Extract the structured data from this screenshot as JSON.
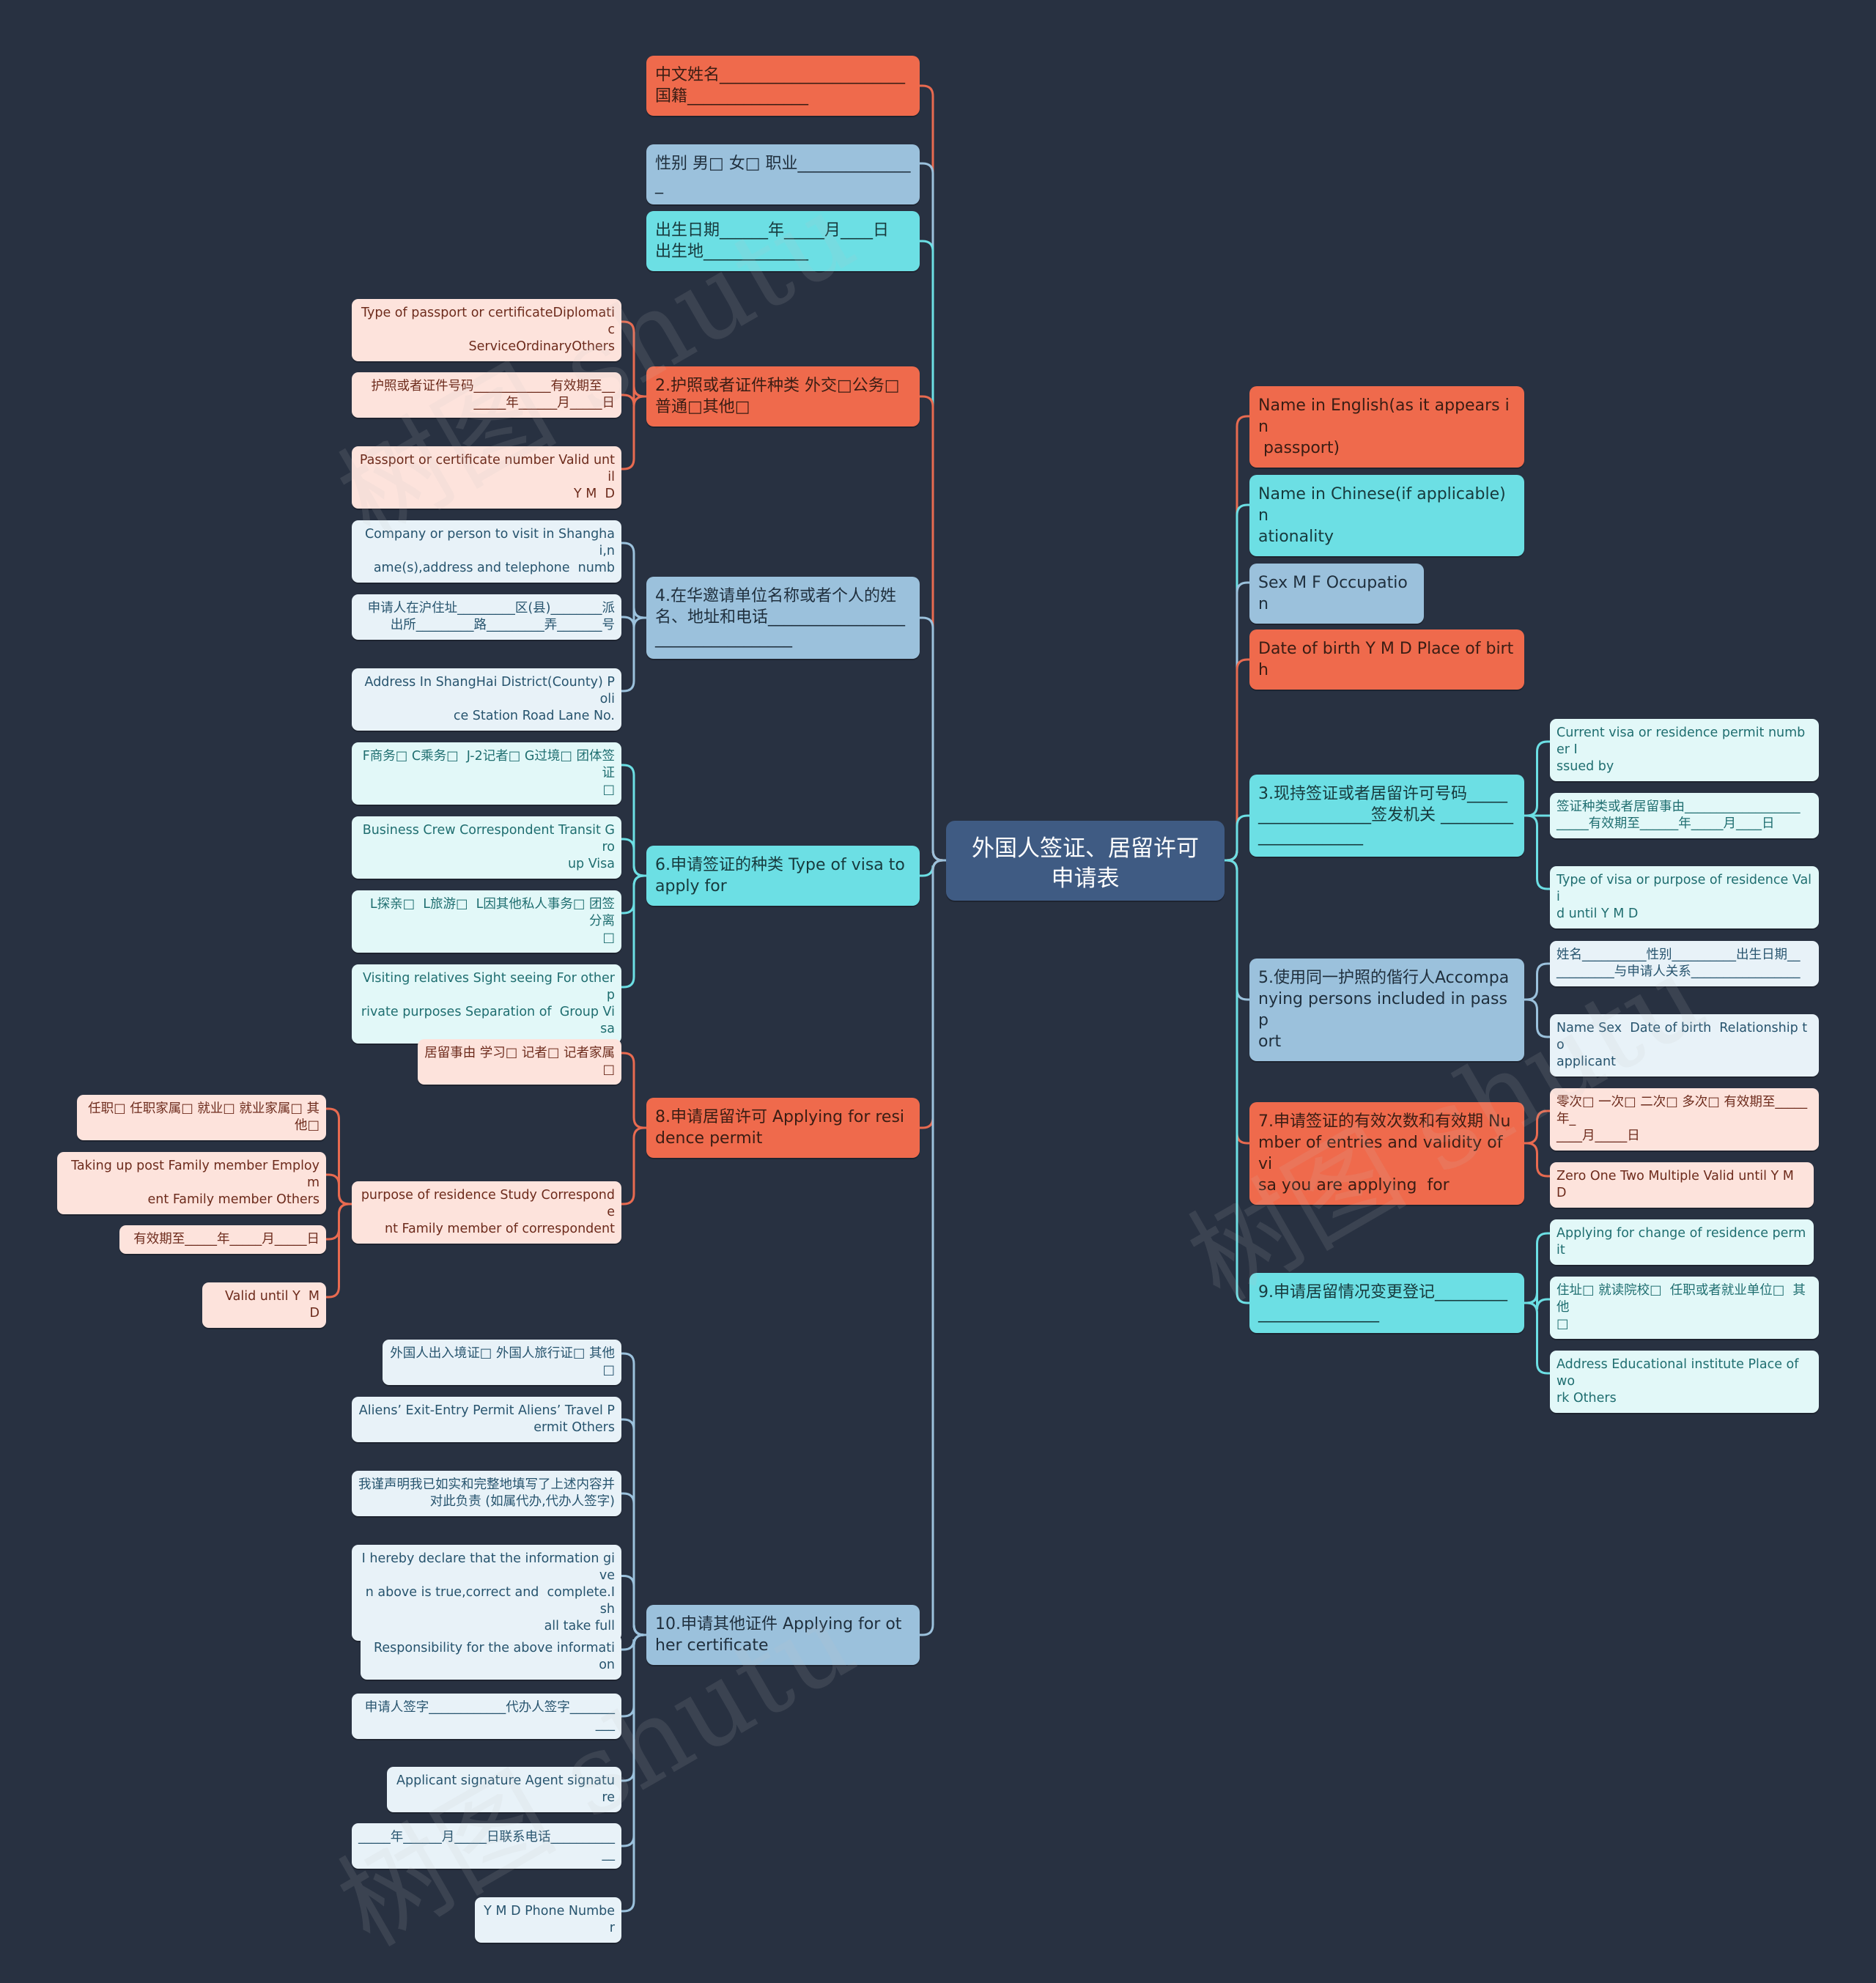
{
  "root": {
    "title": "外国人签证、居留许可申请表"
  },
  "left": [
    {
      "label": "中文姓名_______________________\n国籍_______________",
      "color": "orange",
      "children": []
    },
    {
      "label": "性别 男□ 女□ 职业_______________",
      "color": "blue",
      "children": []
    },
    {
      "label": "出生日期______年_____月____日\n出生地_____________",
      "color": "cyan",
      "children": []
    },
    {
      "label": "2.护照或者证件种类 外交□公务□\n普通□其他□",
      "color": "orange",
      "children": [
        {
          "label": "Type of passport or certificateDiplomatic\nServiceOrdinaryOthers"
        },
        {
          "label": "护照或者证件号码____________有效期至__\n_____年______月_____日"
        },
        {
          "label": "Passport or certificate number Valid until\nY M  D"
        }
      ]
    },
    {
      "label": "4.在华邀请单位名称或者个人的姓名、地址和电话_________________\n_________________",
      "color": "blue",
      "children": [
        {
          "label": "Company or person to visit in Shanghai,n\name(s),address and telephone  numb"
        },
        {
          "label": "申请人在沪住址_________区(县)________派\n出所_________路_________弄_______号"
        },
        {
          "label": "Address In ShangHai District(County) Poli\nce Station Road Lane No."
        }
      ]
    },
    {
      "label": "6.申请签证的种类 Type of visa to\napply for",
      "color": "cyan",
      "children": [
        {
          "label": "F商务□ C乘务□  J-2记者□ G过境□ 团体签证\n□"
        },
        {
          "label": "Business Crew Correspondent Transit Gro\nup Visa"
        },
        {
          "label": "L探亲□  L旅游□  L因其他私人事务□ 团签分离\n□"
        },
        {
          "label": "Visiting relatives Sight seeing For other p\nrivate purposes Separation of  Group Visa"
        }
      ]
    },
    {
      "label": "8.申请居留许可 Applying for resi\ndence permit",
      "color": "orange",
      "children": [
        {
          "label": "居留事由 学习□ 记者□ 记者家属□",
          "children": []
        },
        {
          "label": "purpose of residence Study Corresponde\nnt Family member of correspondent",
          "children": [
            {
              "label": "任职□ 任职家属□ 就业□ 就业家属□ 其他□"
            },
            {
              "label": "Taking up post Family member Employm\nent Family member Others"
            },
            {
              "label": "有效期至_____年_____月_____日"
            },
            {
              "label": "Valid until Y  M  D"
            }
          ]
        }
      ]
    },
    {
      "label": "10.申请其他证件 Applying for ot\nher certificate",
      "color": "blue",
      "children": [
        {
          "label": "外国人出入境证□ 外国人旅行证□ 其他□"
        },
        {
          "label": "Aliens’ Exit-Entry Permit Aliens’ Travel P\nermit Others"
        },
        {
          "label": "我谨声明我已如实和完整地填写了上述内容并\n对此负责 (如属代办,代办人签字)"
        },
        {
          "label": "I hereby declare that the information give\nn above is true,correct and  complete.I sh\nall take full"
        },
        {
          "label": "Responsibility for the above information"
        },
        {
          "label": "申请人签字____________代办人签字_______\n___"
        },
        {
          "label": "Applicant signature Agent signature"
        },
        {
          "label": "_____年______月_____日联系电话__________\n__"
        },
        {
          "label": "Y M D Phone Number"
        }
      ]
    }
  ],
  "right": [
    {
      "label": "Name in English(as it appears in\n passport)",
      "color": "orange",
      "children": []
    },
    {
      "label": "Name in Chinese(if applicable)n\nationality",
      "color": "cyan",
      "children": []
    },
    {
      "label": "Sex M F Occupation",
      "color": "blue",
      "children": []
    },
    {
      "label": "Date of birth Y M D Place of birt\nh",
      "color": "orange",
      "children": []
    },
    {
      "label": "3.现持签证或者居留许可号码_____\n______________签发机关 _________\n_____________",
      "color": "cyan",
      "children": [
        {
          "label": "Current visa or residence permit number I\nssued by"
        },
        {
          "label": "签证种类或者居留事由__________________\n_____有效期至______年_____月____日"
        },
        {
          "label": "Type of visa or purpose of residence Vali\nd until Y M D"
        }
      ]
    },
    {
      "label": "5.使用同一护照的偕行人Accompa\nnying persons included in passp\nort",
      "color": "blue",
      "children": [
        {
          "label": "姓名__________性别__________出生日期__\n_________与申请人关系_________________"
        },
        {
          "label": "Name Sex  Date of birth  Relationship to\napplicant"
        }
      ]
    },
    {
      "label": "7.申请签证的有效次数和有效期 Nu\nmber of entries and validity of vi\nsa you are applying  for",
      "color": "orange",
      "children": [
        {
          "label": "零次□ 一次□ 二次□ 多次□ 有效期至_____年_\n____月_____日"
        },
        {
          "label": "Zero One Two Multiple Valid until Y M D"
        }
      ]
    },
    {
      "label": "9.申请居留情况变更登记_________\n_______________",
      "color": "cyan",
      "children": [
        {
          "label": "Applying for change of residence permit"
        },
        {
          "label": "住址□ 就读院校□  任职或者就业单位□  其他\n□"
        },
        {
          "label": "Address Educational institute Place of wo\nrk Others"
        }
      ]
    }
  ],
  "colors": {
    "background": "#283141",
    "root": "#3f5b83",
    "orange": "#ef6a4c",
    "cyan": "#6cdfe4",
    "blue": "#9bc1dc",
    "pink_leaf": "#fde3dc",
    "mint_leaf": "#e2f8f8",
    "pale_leaf": "#e8f2f8"
  },
  "watermark": "树图 shutu"
}
